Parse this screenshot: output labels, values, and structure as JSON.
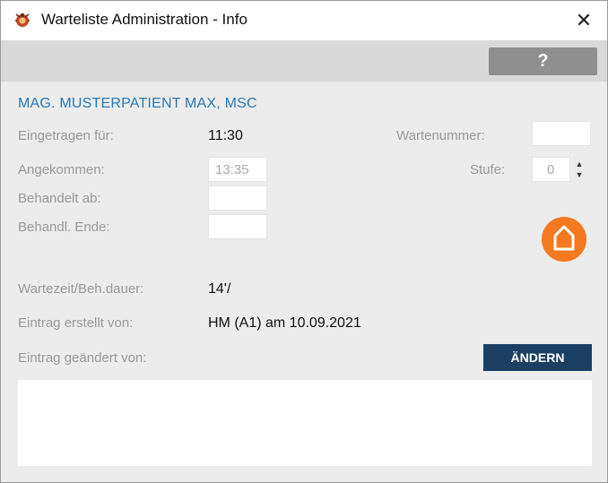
{
  "window": {
    "title": "Warteliste Administration - Info",
    "close_glyph": "✕"
  },
  "toolbar": {
    "help_label": "?"
  },
  "patient": {
    "name": "MAG. MUSTERPATIENT MAX, MSC"
  },
  "fields": {
    "eingetragen_label": "Eingetragen für:",
    "eingetragen_value": "11:30",
    "wartenummer_label": "Wartenummer:",
    "wartenummer_value": "",
    "angekommen_label": "Angekommen:",
    "angekommen_value": "13:35",
    "stufe_label": "Stufe:",
    "stufe_value": "0",
    "behandelt_label": "Behandelt ab:",
    "behandelt_value": "",
    "ende_label": "Behandl. Ende:",
    "ende_value": "",
    "wartezeit_label": "Wartezeit/Beh.dauer:",
    "wartezeit_value": "14'/",
    "erstellt_label": "Eintrag erstellt von:",
    "erstellt_value": "HM (A1) am 10.09.2021",
    "geaendert_label": "Eintrag geändert von:",
    "geaendert_value": ""
  },
  "buttons": {
    "aendern_label": "ÄNDERN"
  },
  "icons": {
    "app": "bug-icon",
    "home": "home-icon",
    "spinner": "stepper-arrows-icon"
  },
  "colors": {
    "accent_blue": "#2878b4",
    "home_orange": "#f47920",
    "button_navy": "#1a3f63"
  },
  "notes": {
    "value": ""
  }
}
